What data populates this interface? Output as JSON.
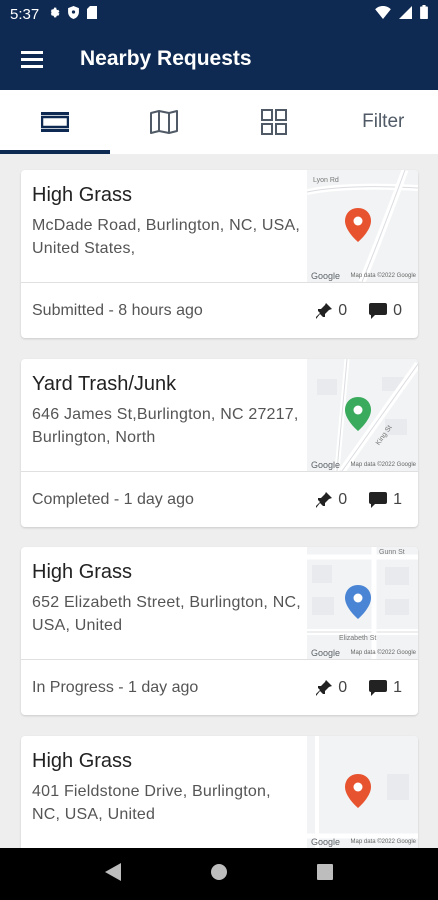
{
  "status_bar": {
    "time": "5:37"
  },
  "app_bar": {
    "title": "Nearby Requests"
  },
  "tabs": {
    "filter_label": "Filter"
  },
  "requests": [
    {
      "title": "High Grass",
      "address": "McDade Road, Burlington, NC, USA, United States,",
      "status": "Submitted - 8 hours ago",
      "pins": "0",
      "comments": "0",
      "pin_color": "#e8532f",
      "map_road_label": "Lyon Rd",
      "google_label": "Google",
      "map_data_label": "Map data ©2022 Google"
    },
    {
      "title": "Yard Trash/Junk",
      "address": "646 James St,Burlington, NC 27217, Burlington, North",
      "status": "Completed - 1 day ago",
      "pins": "0",
      "comments": "1",
      "pin_color": "#3aaa5c",
      "map_road_label": "King St",
      "google_label": "Google",
      "map_data_label": "Map data ©2022 Google"
    },
    {
      "title": "High Grass",
      "address": "652 Elizabeth Street, Burlington, NC, USA, United",
      "status": "In Progress - 1 day ago",
      "pins": "0",
      "comments": "1",
      "pin_color": "#4a84d4",
      "map_road_label": "Gunn St",
      "map_road_label_2": "Elizabeth St",
      "google_label": "Google",
      "map_data_label": "Map data ©2022 Google"
    },
    {
      "title": "High Grass",
      "address": "401 Fieldstone Drive, Burlington, NC, USA, United",
      "status": "",
      "pins": "",
      "comments": "",
      "pin_color": "#e8532f",
      "google_label": "Google",
      "map_data_label": "Map data ©2022 Google"
    }
  ]
}
